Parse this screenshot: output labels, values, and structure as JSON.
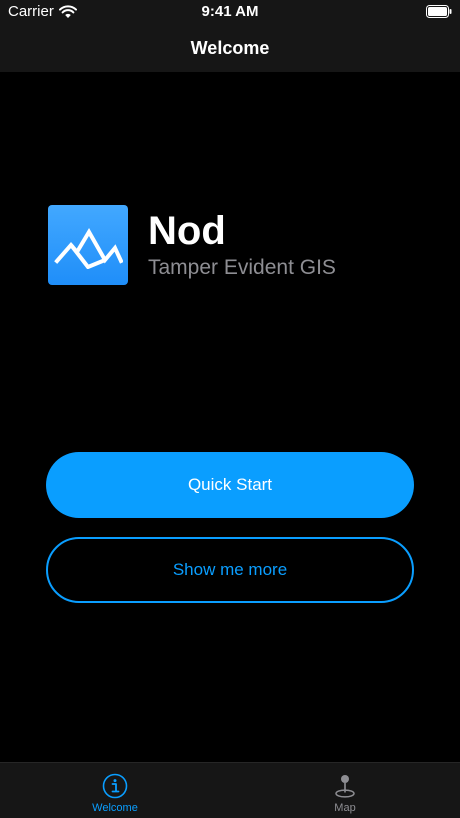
{
  "status_bar": {
    "carrier": "Carrier",
    "time": "9:41 AM"
  },
  "nav": {
    "title": "Welcome"
  },
  "hero": {
    "app_name": "Nod",
    "tagline": "Tamper Evident GIS",
    "logo_icon": "mountain-logo-icon"
  },
  "buttons": {
    "quick_start": "Quick Start",
    "show_more": "Show me more"
  },
  "tab_bar": {
    "tabs": [
      {
        "label": "Welcome",
        "icon": "info-circle-icon",
        "active": true
      },
      {
        "label": "Map",
        "icon": "map-pin-icon",
        "active": false
      }
    ]
  },
  "colors": {
    "accent": "#0a9eff",
    "background": "#000000",
    "bar_background": "#161616",
    "secondary_text": "#8e8e93"
  }
}
